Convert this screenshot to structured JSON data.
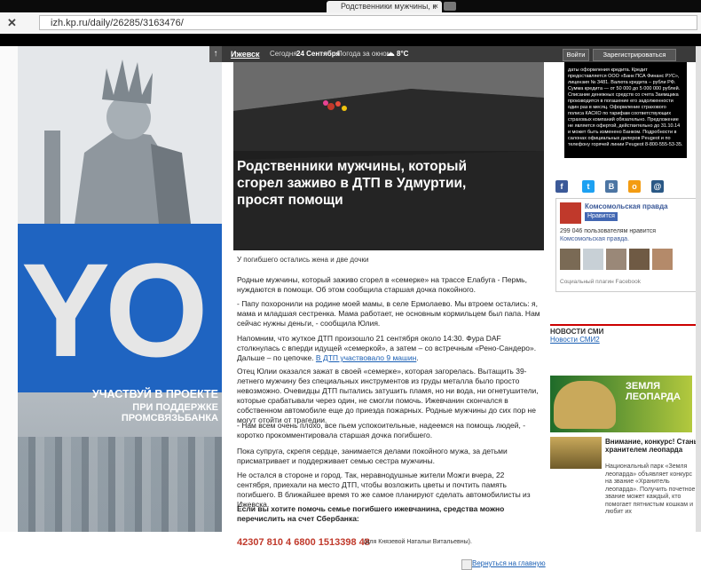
{
  "browser": {
    "tab_title": "Родственники мужчины, к",
    "url": "izh.kp.ru/daily/26285/3163476/"
  },
  "topnav": {
    "city": "Ижевск",
    "date_prefix": "Сегодня",
    "date": "24 Сентября",
    "weather_label": "Погода за окном",
    "temperature": "8°C",
    "login_label": "Войти",
    "register_label": "Зарегистрироваться"
  },
  "left_ad": {
    "big": "YO",
    "line1": "УЧАСТВУЙ В ПРОЕКТЕ",
    "line2": "ПРИ ПОДДЕРЖКЕ ПРОМСВЯЗЬБАНКА"
  },
  "article": {
    "title": "Родственники мужчины, который сгорел заживо в ДТП в Удмуртии, просят помощи",
    "caption": "У погибшего остались жена и две дочки",
    "p1": "Родные мужчины, который заживо сгорел в «семерке» на трассе Елабуга - Пермь, нуждаются в помощи. Об этом сообщила старшая дочка покойного.",
    "p2": "- Папу похоронили на родине моей мамы, в селе Ермолаево. Мы втроем остались: я, мама и младшая сестренка. Мама работает, не основным кормильцем был папа. Нам сейчас нужны деньги, - сообщила Юлия.",
    "p3": "Напомним, что жуткое ДТП произошло 21 сентября около 14:30. Фура DAF столкнулась с вперди идущей «семеркой», а затем – со встречным «Рено-Сандеро». Дальше – по цепочке.",
    "p3_link": "В ДТП участвовало 9 машин",
    "p4": "Отец Юлии оказался зажат в своей «семерке», которая загорелась. Вытащить 39-летнего мужчину без специальных инструментов из груды металла было просто невозможно. Очевидцы ДТП пытались затушить пламя, но ни вода, ни огнетушители, которые срабатывали через один, не смогли помочь. Ижевчанин скончался в собственном автомобиле еще до приезда пожарных. Родные мужчины до сих пор не могут отойти от трагедии.",
    "p5": "- Нам всем очень плохо, все пьем успокоительные, надеемся на помощь людей, - коротко прокомментировала старшая дочка погибшего.",
    "p6": "Пока супруга, скрепя сердце, занимается делами покойного мужа, за детьми присматривает и поддерживает семью сестра мужчины.",
    "p7": "Не остался в стороне и город. Так, неравнодушные жители Можги вчера, 22 сентября, приехали на место ДТП, чтобы возложить цветы и почтить память погибшего. В ближайшее время то же самое планируют сделать автомобилисты из Ижевска.",
    "p8": "Если вы хотите помочь семье погибшего ижевчанина, средства можно перечислить на счет Сбербанка:",
    "account": "42307 810 4 6800 1513398 48",
    "account_note": "(для Князевой Натальи Витальевны).",
    "back_link": "Вернуться на главную"
  },
  "right": {
    "ad_text": "даты оформления кредита. Кредит предоставляется ООО «Банк ПСА Финанс РУС», лицензия № 3481. Валюта кредита – рубли РФ. Сумма кредита — от 50 000 до 5 000 000 рублей. Списание денежных средств со счета Заемщика производится в погашение его задолженности один раз в месяц. Оформление страхового полиса КАСКО по тарифам соответствующих страховых компаний обязательно. Предложение не является офертой, действительно до 31.10.14 и может быть изменено Банком. Подробности в салонах официальных дилеров Peugeot и по телефону горячей линии Peugeot 8-800-555-53-35.",
    "fb": {
      "page_name": "Комсомольская правда",
      "like_label": "Нравится",
      "count_text": "299 046 пользователям нравится",
      "page_link": "Комсомольская правда.",
      "plugin_label": "Социальный плагин Facebook"
    },
    "news_header": "НОВОСТИ СМИ",
    "news_link": "Новости СМИ2",
    "leopard": {
      "title1": "ЗЕМЛЯ",
      "title2": "ЛЕОПАРДА",
      "headline": "Внимание, конкурс! Стань хранителем леопарда",
      "text": "Национальный парк «Земля леопарда» объявляет конкурс на звание «Хранитель леопарда». Получить почетное звание может каждый, кто помогает пятнистым кошкам и любит их"
    }
  }
}
